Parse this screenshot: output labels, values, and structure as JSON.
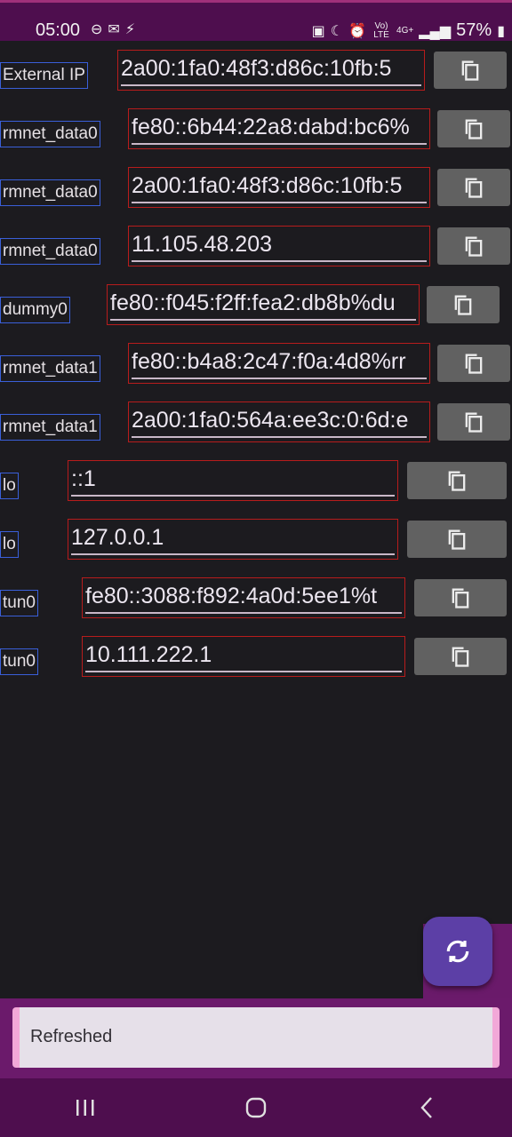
{
  "status": {
    "time": "05:00",
    "battery": "57%",
    "network_top": "Vo) LTE",
    "network_gen": "4G+"
  },
  "rows": [
    {
      "iface": "External IP",
      "ip": "2a00:1fa0:48f3:d86c:10fb:5"
    },
    {
      "iface": "rmnet_data0",
      "ip": "fe80::6b44:22a8:dabd:bc6%"
    },
    {
      "iface": "rmnet_data0",
      "ip": "2a00:1fa0:48f3:d86c:10fb:5"
    },
    {
      "iface": "rmnet_data0",
      "ip": "11.105.48.203"
    },
    {
      "iface": "dummy0",
      "ip": "fe80::f045:f2ff:fea2:db8b%du"
    },
    {
      "iface": "rmnet_data1",
      "ip": "fe80::b4a8:2c47:f0a:4d8%rr"
    },
    {
      "iface": "rmnet_data1",
      "ip": "2a00:1fa0:564a:ee3c:0:6d:e"
    },
    {
      "iface": "lo",
      "ip": "::1"
    },
    {
      "iface": "lo",
      "ip": "127.0.0.1"
    },
    {
      "iface": "tun0",
      "ip": "fe80::3088:f892:4a0d:5ee1%t"
    },
    {
      "iface": "tun0",
      "ip": "10.111.222.1"
    }
  ],
  "snackbar": {
    "message": "Refreshed"
  },
  "colors": {
    "fab": "#5c3fa6",
    "copy_button": "#616161",
    "background": "#1c1b1f"
  },
  "icons": {
    "copy": "copy-icon",
    "refresh": "refresh-icon"
  }
}
